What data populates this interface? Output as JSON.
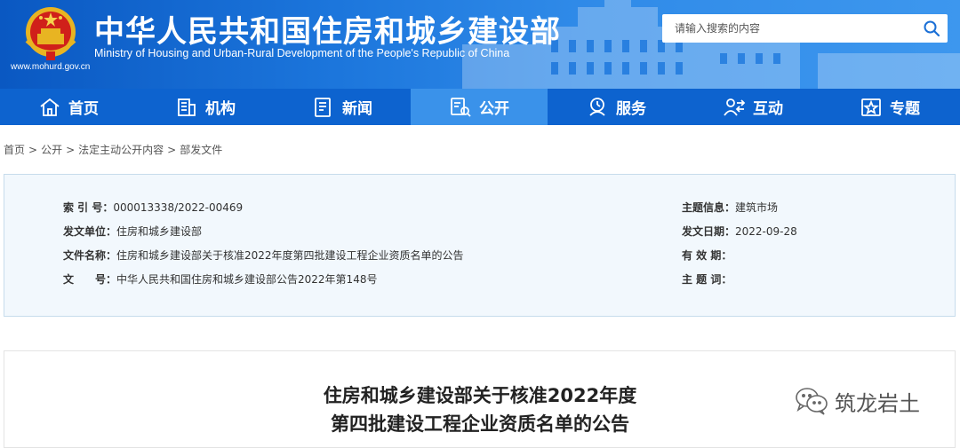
{
  "header": {
    "title_cn": "中华人民共和国住房和城乡建设部",
    "title_en": "Ministry of Housing and Urban-Rural Development of the People's Republic of China",
    "url": "www.mohurd.gov.cn",
    "search": {
      "placeholder": "请输入搜索的内容"
    }
  },
  "nav": {
    "items": [
      {
        "label": "首页",
        "icon": "home-icon"
      },
      {
        "label": "机构",
        "icon": "building-icon"
      },
      {
        "label": "新闻",
        "icon": "news-icon"
      },
      {
        "label": "公开",
        "icon": "disclosure-icon",
        "active": true
      },
      {
        "label": "服务",
        "icon": "service-icon"
      },
      {
        "label": "互动",
        "icon": "interaction-icon"
      },
      {
        "label": "专题",
        "icon": "topic-icon"
      }
    ]
  },
  "breadcrumb": [
    "首页",
    "公开",
    "法定主动公开内容",
    "部发文件"
  ],
  "info": {
    "index_no_label": "索 引 号：",
    "index_no": "000013338/2022-00469",
    "issuer_label": "发文单位：",
    "issuer": "住房和城乡建设部",
    "doc_name_label": "文件名称：",
    "doc_name": "住房和城乡建设部关于核准2022年度第四批建设工程企业资质名单的公告",
    "doc_no_label": "文　　号：",
    "doc_no": "中华人民共和国住房和城乡建设部公告2022年第148号",
    "topic_label": "主题信息：",
    "topic": "建筑市场",
    "date_label": "发文日期：",
    "date": "2022-09-28",
    "validity_label": "有 效 期：",
    "validity": "",
    "keywords_label": "主 题 词：",
    "keywords": ""
  },
  "content": {
    "title_line1": "住房和城乡建设部关于核准2022年度",
    "title_line2": "第四批建设工程企业资质名单的公告"
  },
  "watermark": {
    "text": "筑龙岩土"
  },
  "colors": {
    "banner": "#1c76dc",
    "nav": "#0d63cf",
    "nav_active": "#3a92ea",
    "info_bg": "#f2f8fd"
  }
}
